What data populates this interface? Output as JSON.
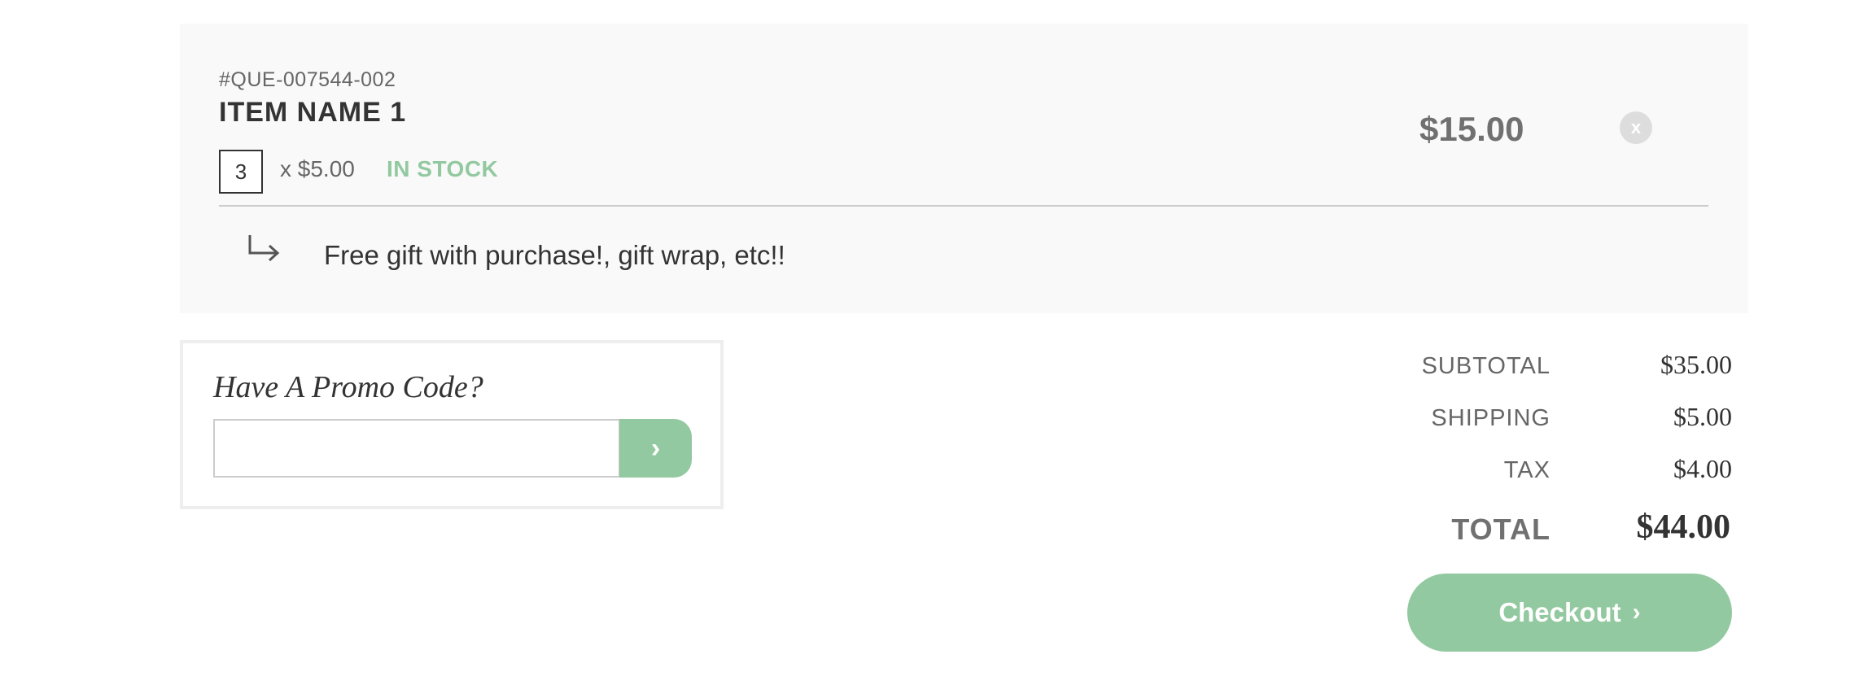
{
  "cart_item": {
    "sku": "#QUE-007544-002",
    "name": "ITEM NAME 1",
    "quantity": "3",
    "unit_price": "x $5.00",
    "stock_status": "IN STOCK",
    "line_total": "$15.00",
    "remove_label": "x",
    "addon_icon": "return-arrow-icon",
    "addon_text": "Free gift with purchase!, gift wrap, etc!!"
  },
  "promo": {
    "title": "Have A Promo Code?",
    "input_value": "",
    "submit_label": "›",
    "submit_icon": "chevron-right-icon"
  },
  "summary": {
    "subtotal_label": "SUBTOTAL",
    "subtotal_value": "$35.00",
    "shipping_label": "SHIPPING",
    "shipping_value": "$5.00",
    "tax_label": "TAX",
    "tax_value": "$4.00",
    "total_label": "TOTAL",
    "total_value": "$44.00"
  },
  "checkout": {
    "label": "Checkout",
    "chevron": "›",
    "icon": "chevron-right-icon"
  },
  "colors": {
    "accent_green": "#93c9a0",
    "card_background": "#f9f9f9",
    "text_dark": "#333333",
    "text_muted": "#666666"
  }
}
